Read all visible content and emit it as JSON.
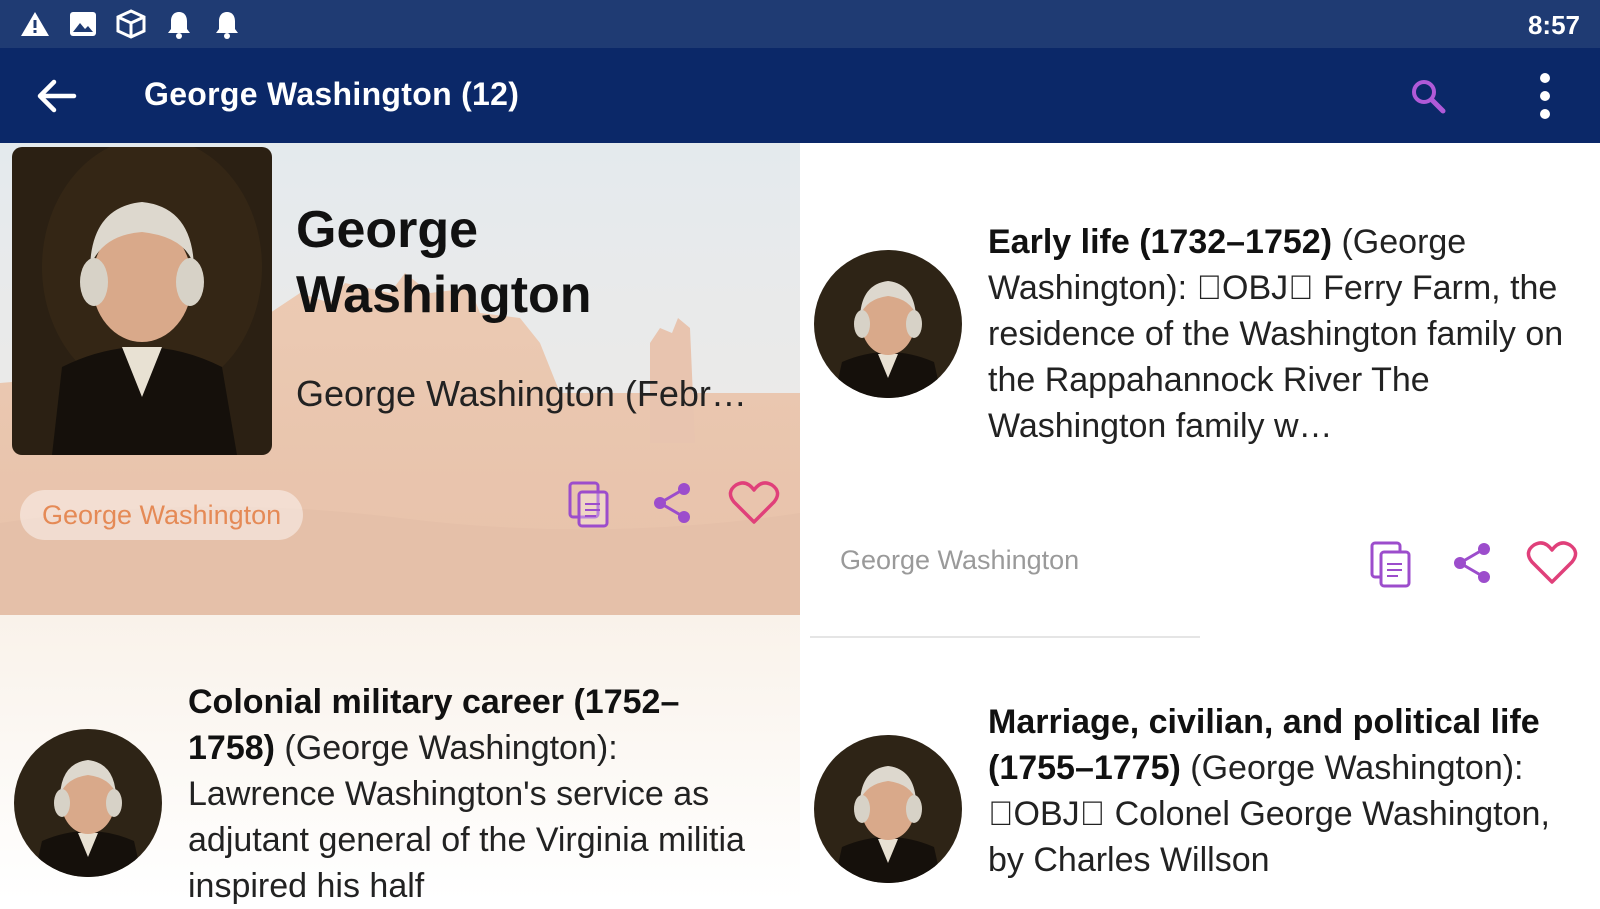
{
  "status_bar": {
    "time": "8:57",
    "icons": [
      "warning-icon",
      "image-icon",
      "package-icon",
      "notification-bell-icon",
      "notification-bell-icon"
    ]
  },
  "app_bar": {
    "title": "George Washington (12)",
    "back_icon": "arrow-back-icon",
    "search_icon": "search-icon",
    "more_icon": "more-vertical-icon"
  },
  "hero_card": {
    "title": "George Washington",
    "snippet": "George Washington (Febr…",
    "tag": "George Washington",
    "actions": [
      "copy-icon",
      "share-icon",
      "heart-icon"
    ]
  },
  "entries": [
    {
      "heading": "Early life (1732–1752)",
      "subject": "(George Washington):",
      "body": "\u0000OBJ\u0000 Ferry Farm, the residence of the Washington family on the Rappahannock River The Washington family w…",
      "source": "George Washington"
    },
    {
      "heading": "Colonial military career (1752–1758)",
      "subject": "(George Washington):",
      "body": "Lawrence Washington's service as adjutant general of the Virginia militia inspired his half"
    },
    {
      "heading": "Marriage, civilian, and political life (1755–1775)",
      "subject": "(George Washington):",
      "body": "\u0000OBJ\u0000 Colonel George Washington, by Charles Willson"
    }
  ],
  "colors": {
    "status_bar": "#1f3b73",
    "app_bar": "#0b2868",
    "action_purple": "#9c4dcc",
    "heart_pink": "#e0407a",
    "tag_orange": "#e58a56"
  }
}
